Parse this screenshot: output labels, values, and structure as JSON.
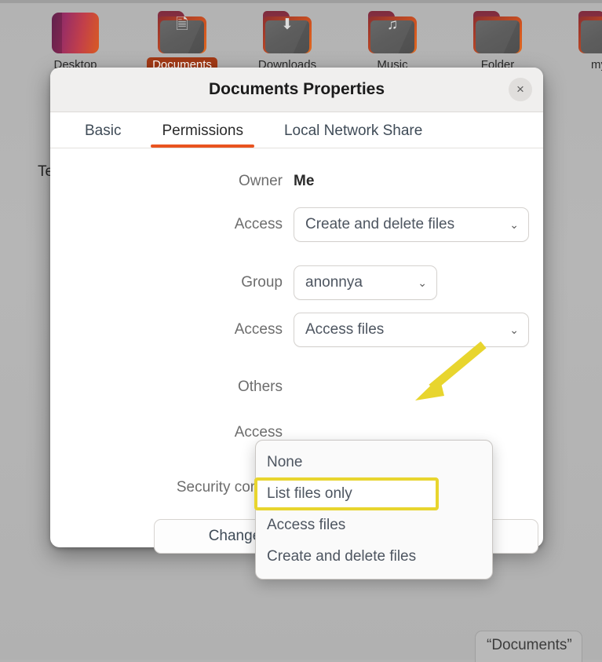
{
  "desktop": {
    "side_text": "Te",
    "icons": [
      {
        "name": "Desktop",
        "art": "home-gradient",
        "glyph": "",
        "selected": false
      },
      {
        "name": "Documents",
        "art": "folder",
        "glyph": "὜E",
        "selected": true
      },
      {
        "name": "Downloads",
        "art": "folder",
        "glyph": "⬇",
        "selected": false
      },
      {
        "name": "Music",
        "art": "folder",
        "glyph": "♫",
        "selected": false
      },
      {
        "name": "Folder",
        "art": "folder",
        "glyph": "",
        "selected": false
      },
      {
        "name": "myS",
        "art": "folder",
        "glyph": "",
        "selected": false
      }
    ],
    "status_pill": "“Documents”"
  },
  "dialog": {
    "title": "Documents Properties",
    "close_label": "×",
    "tabs": [
      {
        "label": "Basic",
        "active": false
      },
      {
        "label": "Permissions",
        "active": true
      },
      {
        "label": "Local Network Share",
        "active": false
      }
    ],
    "permissions": {
      "owner_label": "Owner",
      "owner_value": "Me",
      "owner_access_label": "Access",
      "owner_access_value": "Create and delete files",
      "group_label": "Group",
      "group_value": "anonnya",
      "group_access_label": "Access",
      "group_access_value": "Access files",
      "others_label": "Others",
      "others_access_label": "Access",
      "security_context_label": "Security context",
      "change_permissions_button": "Change Permissions for Enclosed Files…",
      "chevron": "⌄"
    },
    "dropdown": {
      "options": [
        {
          "label": "None",
          "highlighted": false
        },
        {
          "label": "List files only",
          "highlighted": true
        },
        {
          "label": "Access files",
          "highlighted": false
        },
        {
          "label": "Create and delete files",
          "highlighted": false
        }
      ]
    }
  },
  "colors": {
    "accent_orange": "#e95420",
    "selection_rust": "#a33a16",
    "annotation_yellow": "#e8d52e",
    "desktop_gray": "#b4b4b4"
  }
}
